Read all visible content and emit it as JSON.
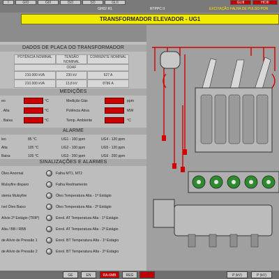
{
  "top": {
    "buttons": [
      "I",
      "GIO",
      "GIII",
      "ISO",
      "SO",
      "GLII",
      "GLIII",
      "HCIII"
    ],
    "status_left": "GH02 R1",
    "status_mid": "RTPPC II",
    "status_right": "EXCITAÇÃO FALHA DE PULSO PON"
  },
  "title": "TRANSFORMADOR ELEVADOR - UG1",
  "dados": {
    "heading": "DADOS DE PLACA DO TRANSFORMADOR",
    "cols": [
      "POTÊNCIA NOMINAL",
      "TENSÃO NOMINAL",
      "CORRENTE NOMINAL"
    ],
    "group": "ODAF",
    "rows": [
      [
        "210.000 kVA",
        "230 kV",
        "527 A"
      ],
      [
        "210.000 kVA",
        "13,8 kV",
        "8786 A"
      ]
    ]
  },
  "medicoes": {
    "heading": "MEDIÇÕES",
    "left": [
      {
        "label": "eo",
        "unit": "°C"
      },
      {
        "label": ". Alta",
        "unit": "°C"
      },
      {
        "label": ". Baixa",
        "unit": "°C"
      }
    ],
    "right": [
      {
        "label": "Medição Gás",
        "unit": "ppm"
      },
      {
        "label": "Potência Ativa",
        "unit": "MW"
      },
      {
        "label": "Temp. Ambiente",
        "unit": "°C"
      }
    ]
  },
  "alarme": {
    "heading": "ALARME",
    "rows": [
      [
        "leo",
        "85 °C",
        "UG1 - 100 ppm",
        "UG4 - 120 ppm"
      ],
      [
        "Alta",
        "105 °C",
        "UG2 - 100 ppm",
        "UG5 - 120 ppm"
      ],
      [
        "Baixa",
        "105 °C",
        "UG3 - 200 ppm",
        "UG6 - 200 ppm"
      ]
    ]
  },
  "sinal": {
    "heading": "SINALIZAÇÕES E ALARMES",
    "left": [
      "Óleo Anormal",
      "Mulsyfire disparo",
      "stema Mulsyfire",
      "ível Óleo Baixo",
      "Alívio 2º Estágio (TRIP)",
      "Alta / BB / RBB",
      "de Alívio de Pressão 1",
      "de Alívio de Pressão 2"
    ],
    "right": [
      "Falha MT1, MT2",
      "Falha Resfriamento",
      "Óleo Temperatura Alta - 1º Estágio",
      "Óleo Temperatura Alta - 2º Estágio",
      "Enrol. AT Temperatura Alta - 1º Estágio",
      "Enrol. AT Temperatura Alta - 2º Estágio",
      "Enrol. BT Temperatura Alta - 1º Estágio",
      "Enrol. BT Temperatura Alta - 2º Estágio"
    ]
  },
  "bottom": {
    "buttons": [
      "GE",
      "EN",
      "RA-6MB",
      "REG",
      "",
      "P (kV)",
      "P (kV)"
    ]
  },
  "colors": {
    "accent_yellow": "#f2ea00",
    "alarm_red": "#cc0000",
    "panel_gray": "#bdbdbd"
  }
}
